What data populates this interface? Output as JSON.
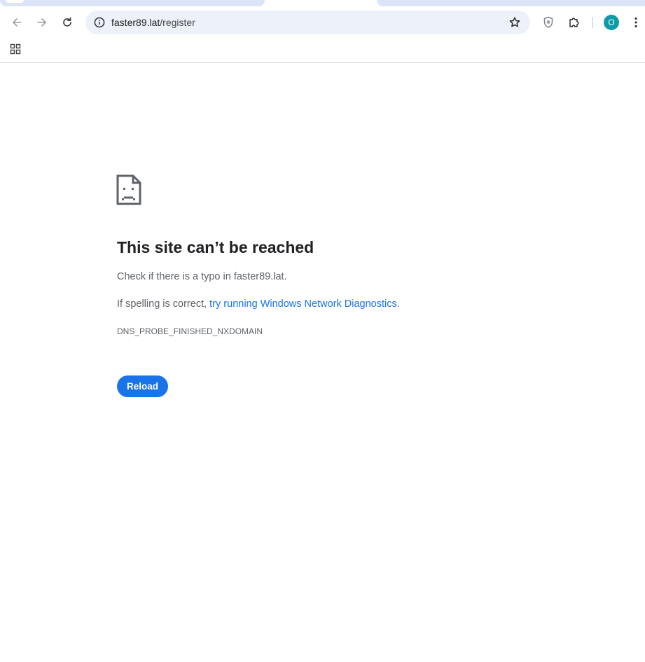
{
  "browser": {
    "url_host": "faster89.lat",
    "url_path": "/register",
    "profile_initial": "O"
  },
  "icons": {
    "back": "arrow-left-icon",
    "forward": "arrow-right-icon",
    "reload": "reload-icon",
    "site_info": "info-icon",
    "bookmark": "star-icon",
    "shield": "shield-icon",
    "extensions": "puzzle-icon",
    "menu": "kebab-menu-icon",
    "apps": "apps-grid-icon",
    "error": "sad-page-icon"
  },
  "error_page": {
    "title": "This site can’t be reached",
    "line1": "Check if there is a typo in faster89.lat.",
    "line2_prefix": "If spelling is correct, ",
    "line2_link": "try running Windows Network Diagnostics",
    "line2_suffix": ".",
    "error_code": "DNS_PROBE_FINISHED_NXDOMAIN",
    "reload_label": "Reload"
  },
  "colors": {
    "accent": "#1a73e8",
    "omnibox_bg": "#edf2fa",
    "avatar_bg": "#0f9aa8"
  }
}
